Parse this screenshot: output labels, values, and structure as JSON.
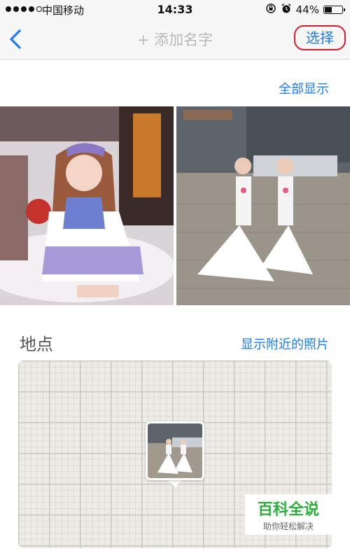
{
  "status_bar": {
    "carrier": "中国移动",
    "time": "14:33",
    "battery": "44%",
    "battery_level": 0.44,
    "signal_dots_filled": 4,
    "signal_dots_total": 5
  },
  "nav": {
    "title": "+ 添加名字",
    "select_label": "选择",
    "accent_color": "#1c7cf2",
    "highlight_color": "#d21e2b"
  },
  "photos": {
    "show_all_label": "全部显示",
    "items": [
      {
        "icon": "photo-cosplay-girl-icon"
      },
      {
        "icon": "photo-two-cosplayers-icon"
      }
    ]
  },
  "location": {
    "title": "地点",
    "nearby_label": "显示附近的照片"
  },
  "watermark": {
    "title": "百科全说",
    "subtitle": "助你轻松解决"
  }
}
